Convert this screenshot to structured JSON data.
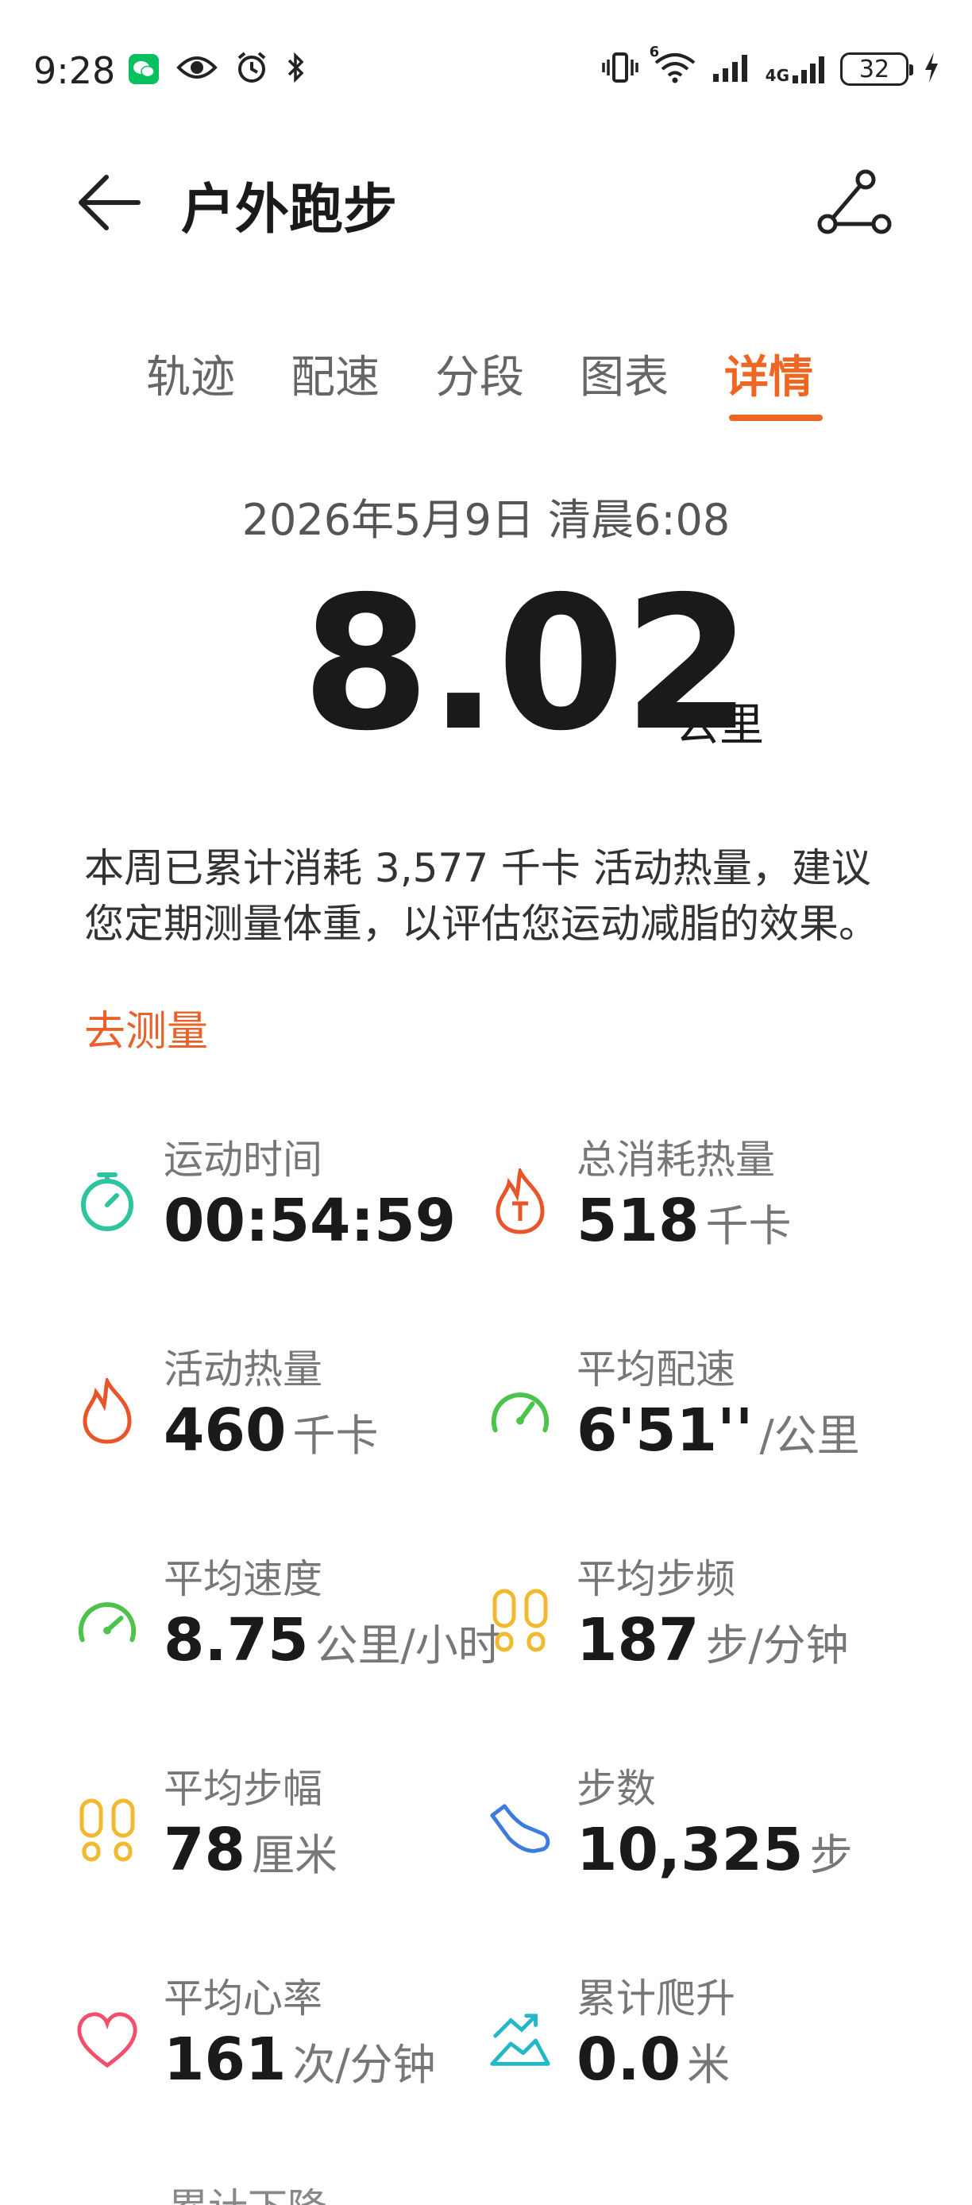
{
  "status_bar": {
    "time": "9:28",
    "battery": "32",
    "network_label": "4G",
    "wifi_label": "6"
  },
  "header": {
    "title": "户外跑步"
  },
  "tabs": [
    {
      "label": "轨迹",
      "active": false
    },
    {
      "label": "配速",
      "active": false
    },
    {
      "label": "分段",
      "active": false
    },
    {
      "label": "图表",
      "active": false
    },
    {
      "label": "详情",
      "active": true
    }
  ],
  "summary": {
    "date": "2026年5月9日 清晨6:08",
    "distance": "8.02",
    "distance_unit": "公里",
    "notice": "本周已累计消耗 3,577 千卡 活动热量，建议您定期测量体重，以评估您运动减脂的效果。",
    "notice_link": "去测量"
  },
  "stats": [
    {
      "label": "运动时间",
      "value": "00:54:59",
      "unit": "",
      "icon": "stopwatch-icon",
      "color": "#2ec4a0"
    },
    {
      "label": "总消耗热量",
      "value": "518",
      "unit": "千卡",
      "icon": "total-calorie-flame-icon",
      "color": "#e8552a"
    },
    {
      "label": "活动热量",
      "value": "460",
      "unit": "千卡",
      "icon": "flame-icon",
      "color": "#e8552a"
    },
    {
      "label": "平均配速",
      "value": "6'51''",
      "unit": "/公里",
      "icon": "speedometer-icon",
      "color": "#4cc44c"
    },
    {
      "label": "平均速度",
      "value": "8.75",
      "unit": "公里/小时",
      "icon": "gauge-icon",
      "color": "#4cc44c"
    },
    {
      "label": "平均步频",
      "value": "187",
      "unit": "步/分钟",
      "icon": "footprints-icon",
      "color": "#f2b92f"
    },
    {
      "label": "平均步幅",
      "value": "78",
      "unit": "厘米",
      "icon": "footprints-icon",
      "color": "#f2b92f"
    },
    {
      "label": "步数",
      "value": "10,325",
      "unit": "步",
      "icon": "shoe-icon",
      "color": "#3d7be0"
    },
    {
      "label": "平均心率",
      "value": "161",
      "unit": "次/分钟",
      "icon": "heart-icon",
      "color": "#f0506e"
    },
    {
      "label": "累计爬升",
      "value": "0.0",
      "unit": "米",
      "icon": "climb-icon",
      "color": "#22b8c8"
    }
  ],
  "partial_label": "累计下降"
}
